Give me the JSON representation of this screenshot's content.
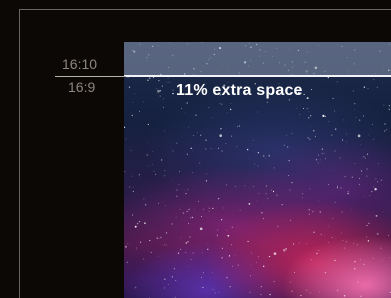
{
  "diagram": {
    "ratio_top": "16:10",
    "ratio_bottom": "16:9",
    "extra_label": "11% extra space"
  },
  "colors": {
    "background": "#0c0806",
    "frame_outline": "#6a6560",
    "ratio_text": "#8c8680",
    "band_overlay": "#afb9cd",
    "band_edge": "#f2f4f8",
    "label_text": "#ffffff"
  }
}
